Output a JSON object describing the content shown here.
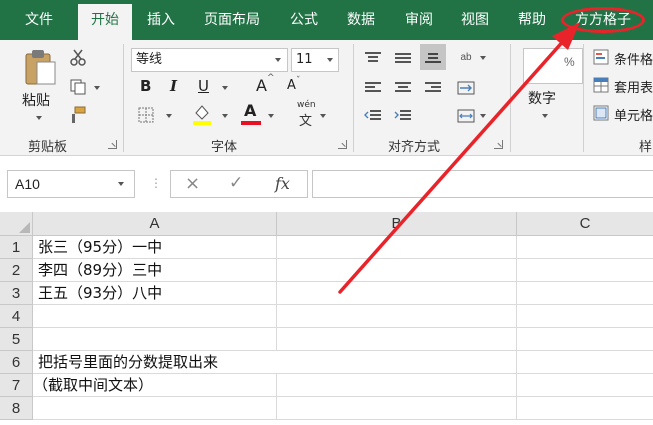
{
  "tabs": [
    "文件",
    "开始",
    "插入",
    "页面布局",
    "公式",
    "数据",
    "审阅",
    "视图",
    "帮助",
    "方方格子"
  ],
  "active_tab": "开始",
  "colors": {
    "accent": "#217346",
    "annotation": "#e8232a",
    "font_color_bar": "#e81123",
    "fill_color_bar": "#ffff00"
  },
  "ribbon": {
    "clipboard": {
      "label": "剪贴板",
      "paste": "粘贴"
    },
    "font": {
      "label": "字体",
      "font_name": "等线",
      "font_size": "11",
      "bold": "B",
      "italic": "I",
      "underline": "U",
      "grow": "A",
      "shrink": "A",
      "font_color_letter": "A",
      "phonetic": "wén"
    },
    "alignment": {
      "label": "对齐方式"
    },
    "number": {
      "label": "数字"
    },
    "styles": {
      "items": [
        "条件格",
        "套用表",
        "单元格"
      ],
      "label": "样"
    }
  },
  "formula_bar": {
    "name_box": "A10",
    "cancel": "×",
    "enter": "✓",
    "fx": "fx",
    "formula": ""
  },
  "columns": [
    "A",
    "B",
    "C"
  ],
  "rows": [
    {
      "num": "1",
      "a": "张三（95分）一中"
    },
    {
      "num": "2",
      "a": "李四（89分）三中"
    },
    {
      "num": "3",
      "a": "王五（93分）八中"
    },
    {
      "num": "4",
      "a": ""
    },
    {
      "num": "5",
      "a": ""
    },
    {
      "num": "6",
      "a": "把括号里面的分数提取出来"
    },
    {
      "num": "7",
      "a": "（截取中间文本）"
    },
    {
      "num": "8",
      "a": ""
    }
  ]
}
